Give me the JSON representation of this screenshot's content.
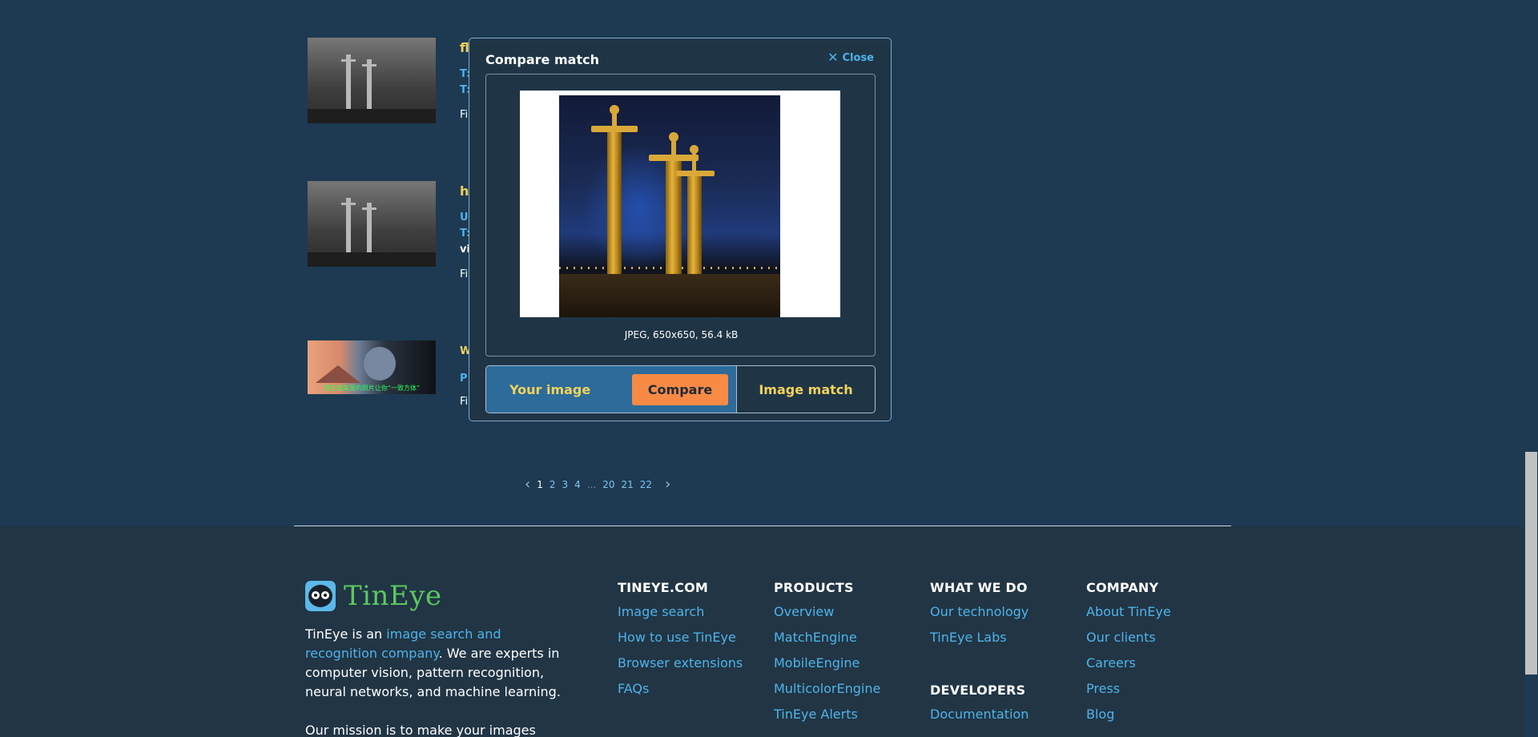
{
  "modal": {
    "title": "Compare match",
    "close_label": "Close",
    "image_meta": "JPEG, 650x650, 56.4 kB",
    "tab_your_image": "Your image",
    "compare_button": "Compare",
    "tab_image_match": "Image match"
  },
  "results": [
    {
      "title_fragment": "fl",
      "link_lines": [
        "T:",
        "T:"
      ],
      "info_fragment": "Fi"
    },
    {
      "title_fragment": "h",
      "link_lines": [
        "U",
        "T:"
      ],
      "extra_fragment": "vi",
      "info_fragment": "Fi"
    },
    {
      "title_fragment": "W",
      "link_lines": [
        "P"
      ],
      "info_fragment": "Fi",
      "thumb_caption": "把这個美丽的照片让你“一致方体”"
    }
  ],
  "pagination": {
    "prev_icon": "chevron-left-icon",
    "pages": [
      "1",
      "2",
      "3",
      "4"
    ],
    "ellipsis": "...",
    "pages_end": [
      "20",
      "21",
      "22"
    ],
    "current": "1",
    "next_icon": "chevron-right-icon"
  },
  "footer": {
    "logo_text": "TinEye",
    "about_prefix": "TinEye is an ",
    "about_link": "image search and recognition company",
    "about_rest": ". We are experts in computer vision, pattern recognition, neural networks, and machine learning.",
    "mission_fragment": "Our mission is to make your images",
    "columns": [
      {
        "heading": "TINEYE.COM",
        "links": [
          "Image search",
          "How to use TinEye",
          "Browser extensions",
          "FAQs"
        ]
      },
      {
        "heading": "PRODUCTS",
        "links": [
          "Overview",
          "MatchEngine",
          "MobileEngine",
          "MulticolorEngine",
          "TinEye Alerts"
        ]
      },
      {
        "heading": "WHAT WE DO",
        "links": [
          "Our technology",
          "TinEye Labs"
        ]
      },
      {
        "heading": "DEVELOPERS",
        "links": [
          "Documentation"
        ]
      },
      {
        "heading": "COMPANY",
        "links": [
          "About TinEye",
          "Our clients",
          "Careers",
          "Press",
          "Blog"
        ]
      }
    ]
  },
  "colors": {
    "page_bg": "#1d3a52",
    "footer_bg": "#213545",
    "link": "#4fb3e8",
    "accent_yellow": "#f2d25a",
    "compare_orange": "#f78a45",
    "logo_green": "#5cc85f"
  }
}
